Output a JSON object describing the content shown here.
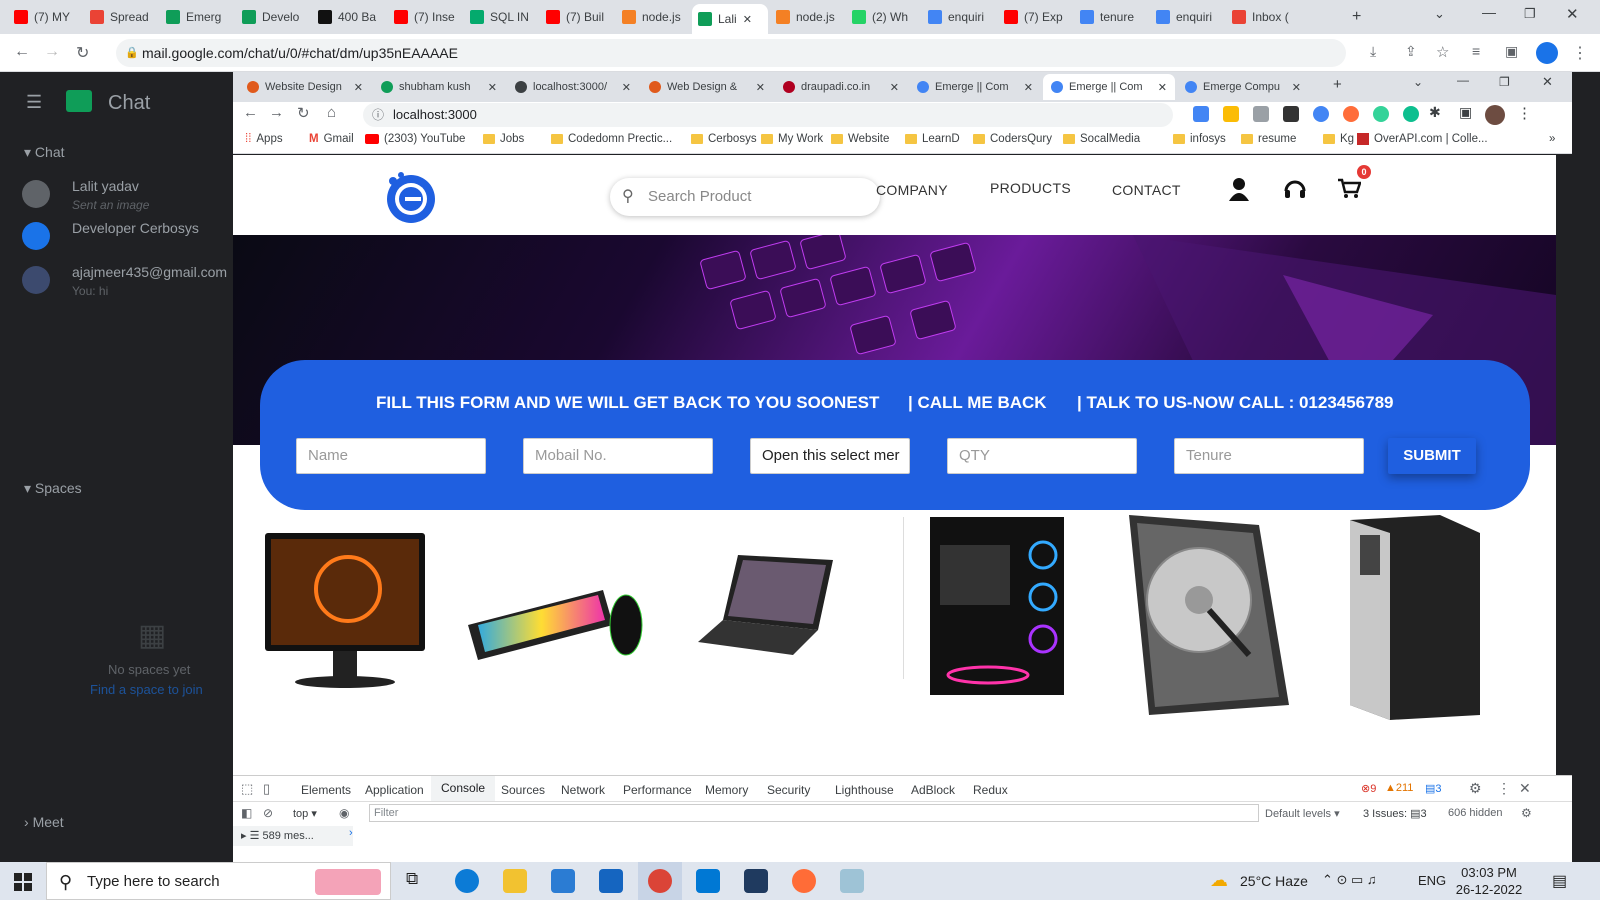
{
  "outer_browser": {
    "tabs": [
      {
        "label": "(7) MY",
        "color": "#ff0000"
      },
      {
        "label": "Spread",
        "color": "#ea4335"
      },
      {
        "label": "Emerg",
        "color": "#0f9d58"
      },
      {
        "label": "Develo",
        "color": "#0f9d58"
      },
      {
        "label": "400 Ba",
        "color": "#111111"
      },
      {
        "label": "(7) Inse",
        "color": "#ff0000"
      },
      {
        "label": "SQL IN",
        "color": "#04aa6d"
      },
      {
        "label": "(7) Buil",
        "color": "#ff0000"
      },
      {
        "label": "node.js",
        "color": "#f48024"
      },
      {
        "label": "Lali",
        "color": "#0f9d58"
      },
      {
        "label": "node.js",
        "color": "#f48024"
      },
      {
        "label": "(2) Wh",
        "color": "#25d366"
      },
      {
        "label": "enquiri",
        "color": "#4285f4"
      },
      {
        "label": "(7) Exp",
        "color": "#ff0000"
      },
      {
        "label": "tenure",
        "color": "#4285f4"
      },
      {
        "label": "enquiri",
        "color": "#4285f4"
      },
      {
        "label": "Inbox (",
        "color": "#ea4335"
      }
    ],
    "url": "mail.google.com/chat/u/0/#chat/dm/up35nEAAAAE"
  },
  "google_chat": {
    "title": "Chat",
    "section_chat": "Chat",
    "people": [
      {
        "name": "Lalit yadav",
        "sub": "Sent an image"
      },
      {
        "name": "Developer Cerbosys",
        "sub": ""
      },
      {
        "name": "ajajmeer435@gmail.com",
        "sub": "You: hi"
      }
    ],
    "section_spaces": "Spaces",
    "no_spaces": "No spaces yet",
    "find_space": "Find a space to join",
    "section_meet": "Meet"
  },
  "inner_browser": {
    "tabs": [
      {
        "label": "Website Design"
      },
      {
        "label": "shubham kush"
      },
      {
        "label": "localhost:3000/"
      },
      {
        "label": "Web Design &"
      },
      {
        "label": "draupadi.co.in"
      },
      {
        "label": "Emerge || Com"
      },
      {
        "label": "Emerge || Com"
      },
      {
        "label": "Emerge Compu"
      }
    ],
    "url": "localhost:3000",
    "bookmarks": [
      "Apps",
      "Gmail",
      "(2303) YouTube",
      "Jobs",
      "Codedomn Prectic...",
      "Cerbosys",
      "My Work",
      "Website",
      "LearnD",
      "CodersQury",
      "SocalMedia",
      "infosys",
      "resume",
      "Kg",
      "OverAPI.com | Colle..."
    ]
  },
  "site": {
    "search_placeholder": "Search Product",
    "nav": [
      "COMPANY",
      "PRODUCTS",
      "CONTACT"
    ],
    "cart_count": "0",
    "form_heading": "FILL THIS FORM AND WE WILL GET BACK TO YOU SOONEST",
    "call_back": "| CALL ME BACK",
    "talk": "| TALK TO US-NOW CALL : 0123456789",
    "name_placeholder": "Name",
    "mobile_placeholder": "Mobail No.",
    "select_value": "Open this select mer",
    "qty_placeholder": "QTY",
    "tenure_placeholder": "Tenure",
    "submit": "SUBMIT"
  },
  "devtools": {
    "tabs": [
      "Elements",
      "Application",
      "Console",
      "Sources",
      "Network",
      "Performance",
      "Memory",
      "Security",
      "Lighthouse",
      "AdBlock",
      "Redux"
    ],
    "errors": "9",
    "warnings": "211",
    "info": "3",
    "context": "top",
    "filter_placeholder": "Filter",
    "levels": "Default levels",
    "issues": "3 Issues:",
    "issues_count": "3",
    "hidden": "606 hidden",
    "messages": "589 mes..."
  },
  "taskbar": {
    "search": "Type here to search",
    "weather": "25°C  Haze",
    "lang": "ENG",
    "time": "03:03 PM",
    "date": "26-12-2022"
  }
}
